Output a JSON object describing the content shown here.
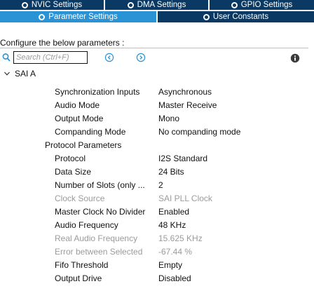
{
  "tabs_row1": [
    {
      "label": "NVIC Settings",
      "active": false
    },
    {
      "label": "DMA Settings",
      "active": false
    },
    {
      "label": "GPIO Settings",
      "active": false
    }
  ],
  "tabs_row2": [
    {
      "label": "Parameter Settings",
      "active": true
    },
    {
      "label": "User Constants",
      "active": false
    }
  ],
  "subtitle": "Configure the below parameters :",
  "search": {
    "placeholder": "Search (Ctrl+F)"
  },
  "group": {
    "label": "SAI A",
    "expanded": true
  },
  "params": [
    {
      "key": "Synchronization Inputs",
      "value": "Asynchronous",
      "disabled": false
    },
    {
      "key": "Audio Mode",
      "value": "Master Receive",
      "disabled": false
    },
    {
      "key": "Output Mode",
      "value": "Mono",
      "disabled": false
    },
    {
      "key": "Companding Mode",
      "value": "No companding mode",
      "disabled": false
    }
  ],
  "subgroup": {
    "label": "Protocol Parameters"
  },
  "protocol_params": [
    {
      "key": "Protocol",
      "value": "I2S Standard",
      "disabled": false
    },
    {
      "key": "Data Size",
      "value": "24 Bits",
      "disabled": false
    },
    {
      "key": "Number of Slots (only ...",
      "value": "2",
      "disabled": false
    },
    {
      "key": "Clock Source",
      "value": "SAI PLL Clock",
      "disabled": true
    },
    {
      "key": "Master Clock No Divider",
      "value": "Enabled",
      "disabled": false
    },
    {
      "key": "Audio Frequency",
      "value": "48 KHz",
      "disabled": false
    },
    {
      "key": "Real Audio Frequency",
      "value": "15.625 KHz",
      "disabled": true
    },
    {
      "key": "Error between Selected",
      "value": "-67.44 %",
      "disabled": true
    },
    {
      "key": "Fifo Threshold",
      "value": "Empty",
      "disabled": false
    },
    {
      "key": "Output Drive",
      "value": "Disabled",
      "disabled": false
    }
  ],
  "colors": {
    "tab_dark": "#0a3a64",
    "tab_active": "#2a93d5",
    "disabled_text": "#9b9b9b",
    "icon_blue": "#2a93d5"
  },
  "icons": {
    "search": "search-icon",
    "prev": "prev-circle-icon",
    "next": "next-circle-icon",
    "info": "info-icon",
    "expand": "chevron-down-icon"
  }
}
